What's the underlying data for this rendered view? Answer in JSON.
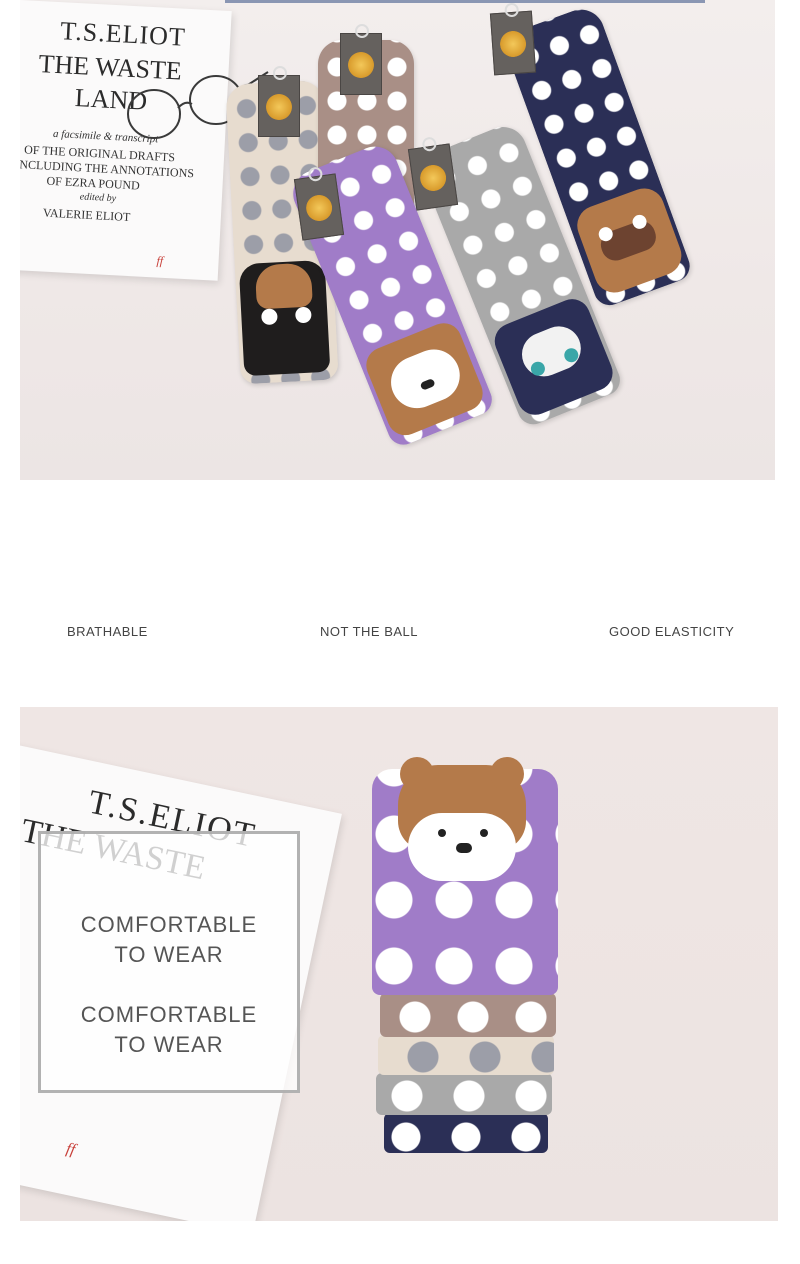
{
  "top_photo": {
    "book": {
      "title_line1": "T.S.ELIOT",
      "title_line2": "THE WASTE",
      "title_line3": "LAND",
      "line1": "a facsimile & transcript",
      "line2": "OF THE ORIGINAL DRAFTS",
      "line3": "INCLUDING THE ANNOTATIONS",
      "line4": "OF EZRA POUND",
      "line5": "edited by",
      "line6": "VALERIE ELIOT",
      "mark": "ff"
    }
  },
  "features": {
    "item1": "BRATHABLE",
    "item2": "NOT THE BALL",
    "item3": "GOOD ELASTICITY"
  },
  "bottom_photo": {
    "book": {
      "title_line1": "T.S.ELIOT",
      "title_line2": "THE WASTE",
      "mark": "ff"
    },
    "overlay": {
      "text1_line1": "COMFORTABLE",
      "text1_line2": "TO WEAR",
      "text2_line1": "COMFORTABLE",
      "text2_line2": "TO WEAR"
    }
  },
  "colors": {
    "sock_beige": "#e7dccf",
    "sock_mauve": "#a98f86",
    "sock_purple": "#a07cc8",
    "sock_grey": "#a9a9a9",
    "sock_navy": "#2b2f56",
    "dog_brown": "#b47a4a",
    "tag_grey": "#65615e"
  }
}
